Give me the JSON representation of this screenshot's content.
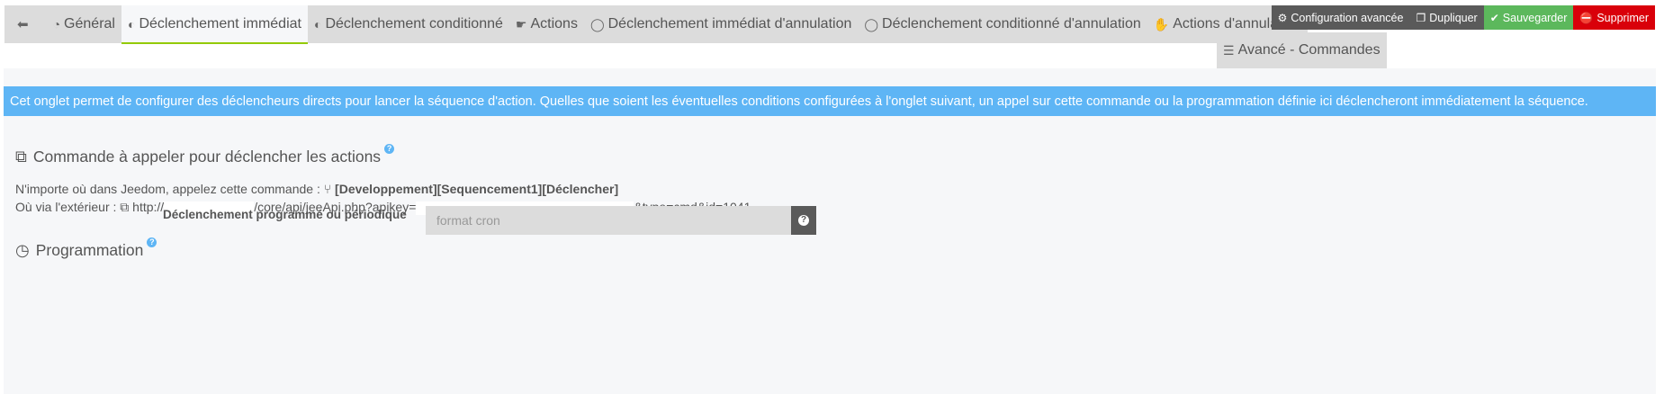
{
  "tabs": [
    {
      "icon": "⬅",
      "label": ""
    },
    {
      "icon": "◔",
      "label": "Général"
    },
    {
      "icon": "◐",
      "label": "Déclenchement immédiat"
    },
    {
      "icon": "◐",
      "label": "Déclenchement conditionné"
    },
    {
      "icon": "☛",
      "label": "Actions"
    },
    {
      "icon": "◯",
      "label": "Déclenchement immédiat d'annulation"
    },
    {
      "icon": "◯",
      "label": "Déclenchement conditionné d'annulation"
    },
    {
      "icon": "✋",
      "label": "Actions d'annulation"
    },
    {
      "icon": "☰",
      "label": "Avancé - Commandes"
    }
  ],
  "toolbar": {
    "advanced_config": "Configuration avancée",
    "duplicate": "Dupliquer",
    "save": "Sauvegarder",
    "delete": "Supprimer"
  },
  "info_text": "Cet onglet permet de configurer des déclencheurs directs pour lancer la séquence d'action. Quelles que soient les éventuelles conditions configurées à l'onglet suivant, un appel sur cette commande ou la programmation définie ici déclencheront immédiatement la séquence.",
  "command_section": {
    "title": "Commande à appeler pour déclencher les actions",
    "anywhere_text": "N'importe où dans Jeedom, appelez cette commande :",
    "command_name": "[Developpement][Sequencement1][Déclencher]",
    "external_text": "Où via l'extérieur :",
    "url_prefix": "http://",
    "url_middle": "/core/api/jeeApi.php?apikey=",
    "url_suffix": "&type=cmd&id=1041"
  },
  "programming_section": {
    "title": "Programmation",
    "cron_label": "Déclenchement programmé ou périodique",
    "cron_placeholder": "format cron",
    "cron_value": ""
  },
  "colors": {
    "info_bg": "#5eb5f5",
    "save": "#5cb85c",
    "delete": "#d9000a",
    "active_tab_underline": "#94ca02"
  }
}
